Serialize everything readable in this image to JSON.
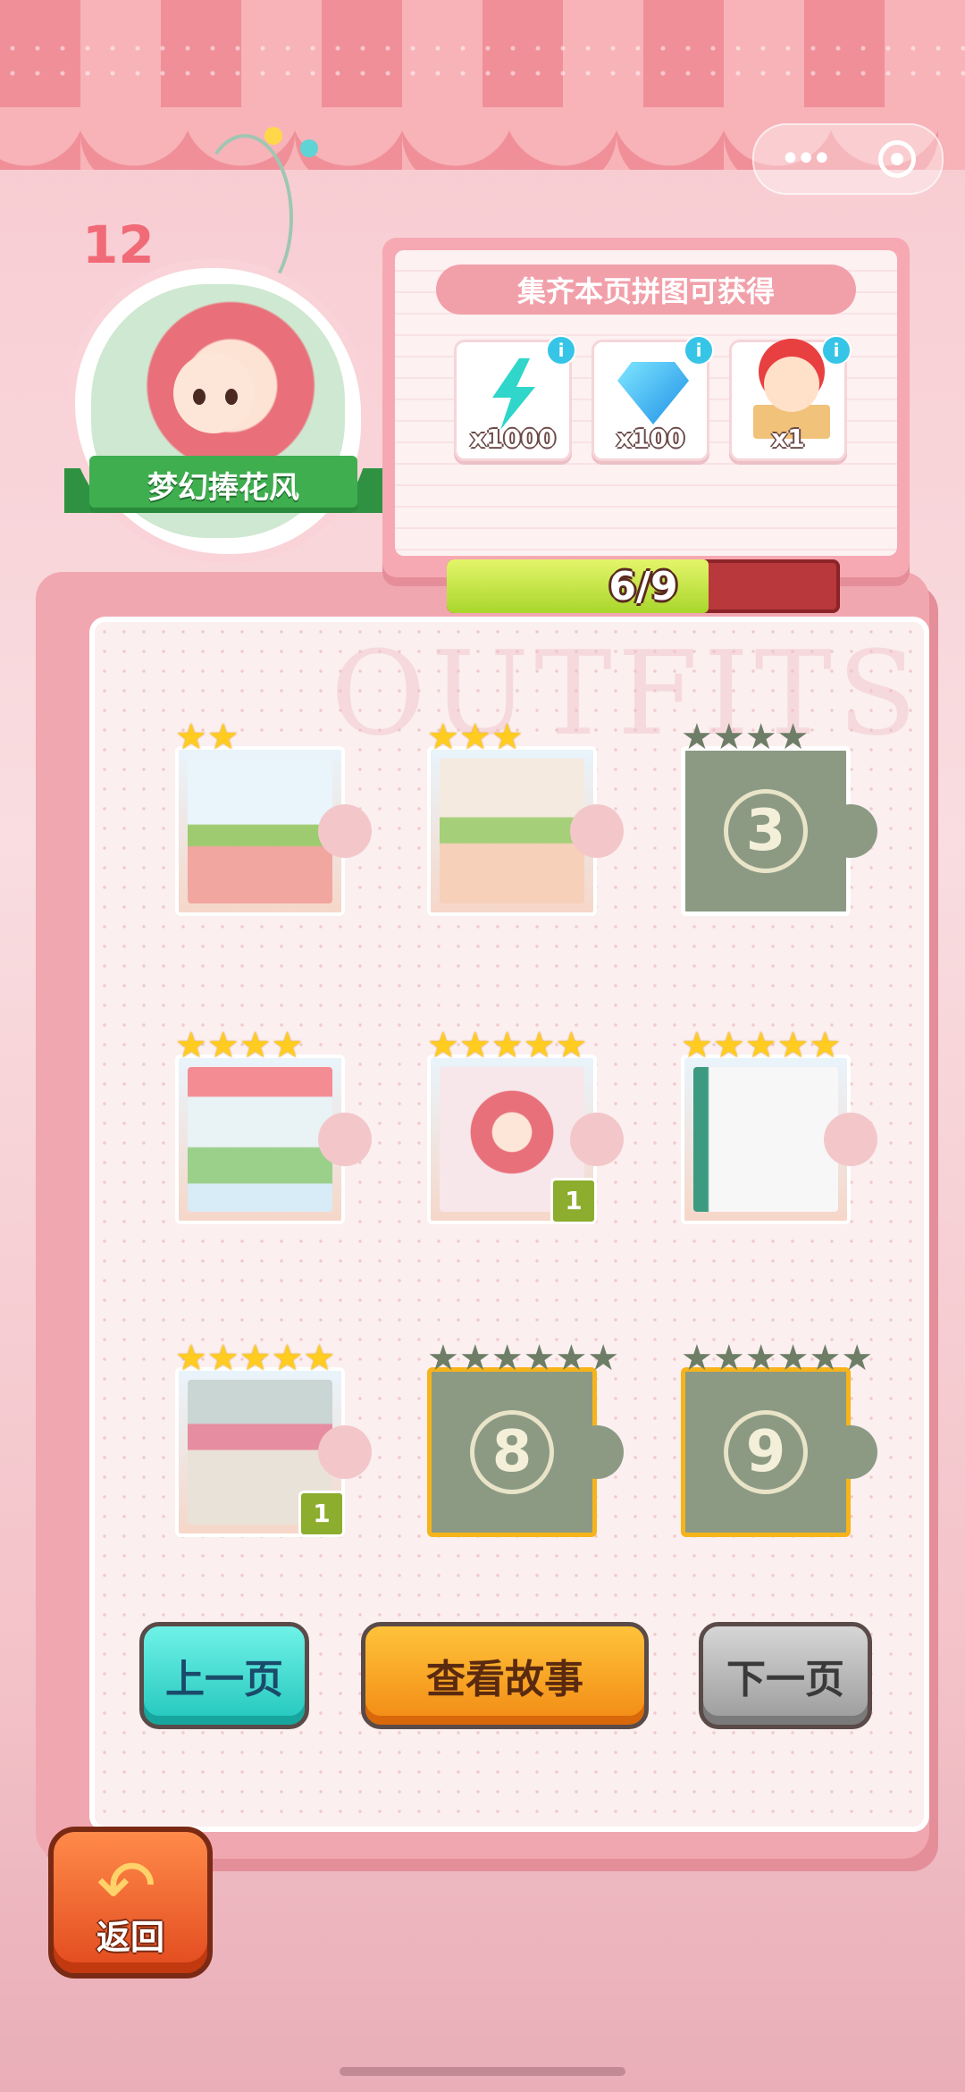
{
  "level": {
    "number": "12",
    "name": "梦幻捧花风"
  },
  "reward": {
    "title": "集齐本页拼图可获得",
    "items": [
      {
        "icon": "energy-bolt-icon",
        "qty": "x1000"
      },
      {
        "icon": "diamond-icon",
        "qty": "x100"
      },
      {
        "icon": "jester-box-icon",
        "qty": "x1"
      }
    ],
    "progress": {
      "collected": 6,
      "total": 9,
      "text": "6/9"
    }
  },
  "puzzle": {
    "pieces": [
      {
        "index": 1,
        "unlocked": true,
        "stars": 2,
        "max_stars": 2
      },
      {
        "index": 2,
        "unlocked": true,
        "stars": 3,
        "max_stars": 3
      },
      {
        "index": 3,
        "unlocked": false,
        "stars": 0,
        "max_stars": 4,
        "label": "3"
      },
      {
        "index": 4,
        "unlocked": true,
        "stars": 4,
        "max_stars": 4
      },
      {
        "index": 5,
        "unlocked": true,
        "stars": 5,
        "max_stars": 5,
        "count": "1"
      },
      {
        "index": 6,
        "unlocked": true,
        "stars": 5,
        "max_stars": 5
      },
      {
        "index": 7,
        "unlocked": true,
        "stars": 5,
        "max_stars": 5,
        "count": "1"
      },
      {
        "index": 8,
        "unlocked": false,
        "stars": 0,
        "max_stars": 6,
        "label": "8"
      },
      {
        "index": 9,
        "unlocked": false,
        "stars": 0,
        "max_stars": 6,
        "label": "9"
      }
    ]
  },
  "buttons": {
    "prev": "上一页",
    "story": "查看故事",
    "next": "下一页",
    "back": "返回"
  },
  "colors": {
    "accent": "#f06b77",
    "progress_fill": "#a9d62c",
    "progress_empty": "#b8383c",
    "star_on": "#ffcc1f",
    "star_off": "#6d7d66"
  }
}
